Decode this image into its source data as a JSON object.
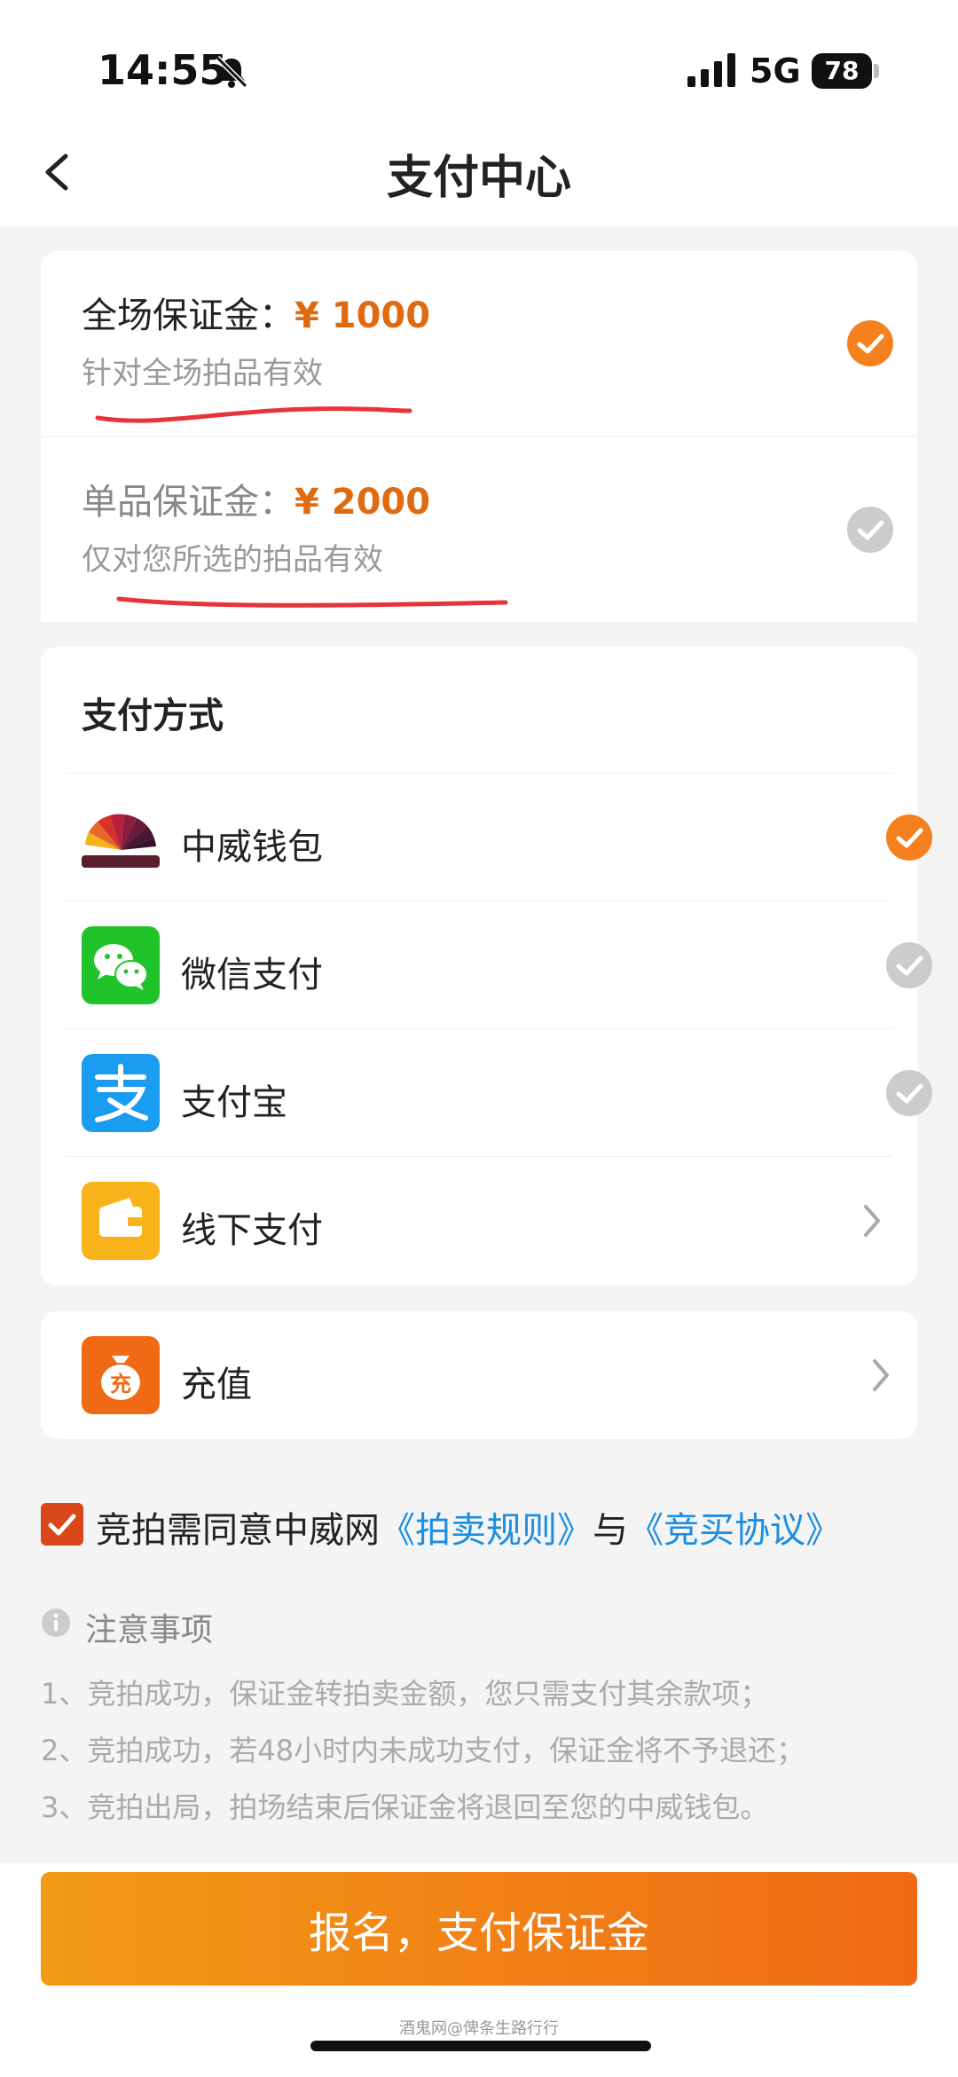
{
  "status_bar": {
    "time": "14:55",
    "network": "5G",
    "battery": "78"
  },
  "nav": {
    "title": "支付中心"
  },
  "deposits": [
    {
      "label": "全场保证金：",
      "amount": "¥ 1000",
      "desc": "针对全场拍品有效",
      "selected": true
    },
    {
      "label": "单品保证金：",
      "amount": "¥ 2000",
      "desc": "仅对您所选的拍品有效",
      "selected": false
    }
  ],
  "payment": {
    "header": "支付方式",
    "methods": [
      {
        "label": "中威钱包",
        "icon": "wallet-fan-icon",
        "selected": true
      },
      {
        "label": "微信支付",
        "icon": "wechat-icon",
        "selected": false
      },
      {
        "label": "支付宝",
        "icon": "alipay-icon",
        "selected": false
      },
      {
        "label": "线下支付",
        "icon": "offline-wallet-icon",
        "selected": false
      }
    ]
  },
  "recharge": {
    "label": "充值",
    "icon_char": "充"
  },
  "agreement": {
    "prefix": "竞拍需同意中威网",
    "link1": "《拍卖规则》",
    "joiner": "与",
    "link2": "《竞买协议》",
    "checked": true
  },
  "notes": {
    "title": "注意事项",
    "items": [
      "1、竞拍成功，保证金转拍卖金额，您只需支付其余款项；",
      "2、竞拍成功，若48小时内未成功支付，保证金将不予退还；",
      "3、竞拍出局，拍场结束后保证金将退回至您的中威钱包。"
    ]
  },
  "submit": {
    "label": "报名，支付保证金"
  },
  "watermark": "酒鬼网@俾条生路行行",
  "colors": {
    "accent": "#f07a16",
    "link": "#1a8ee0",
    "check_active": "#f5811e",
    "check_inactive": "#cccccc"
  }
}
